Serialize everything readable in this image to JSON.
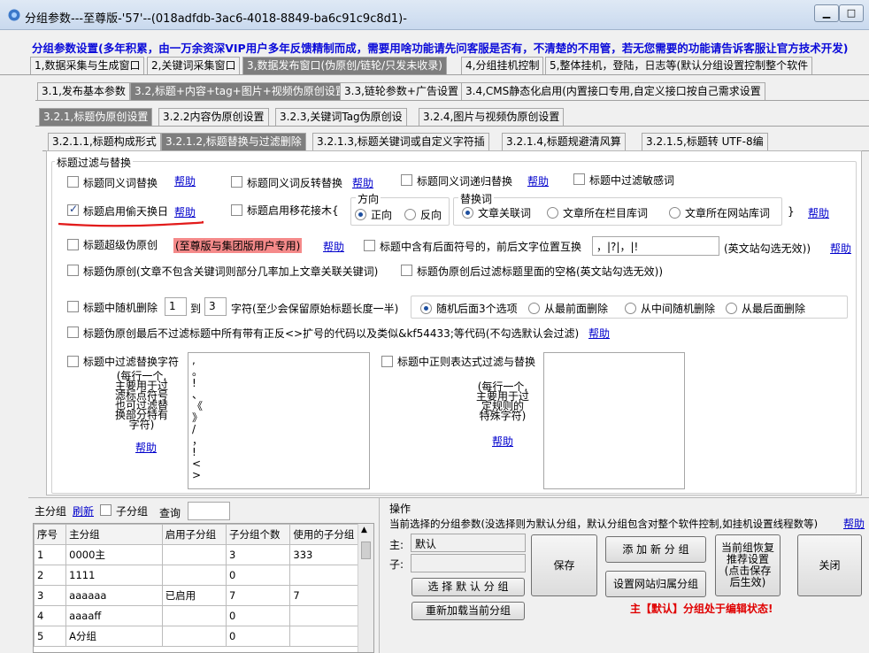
{
  "window": {
    "title": "分组参数---至尊版-'57'--(018adfdb-3ac6-4018-8849-ba6c91c9c8d1)-"
  },
  "notice": "分组参数设置(多年积累，由一万余资深VIP用户多年反馈精制而成，需要用啥功能请先问客服是否有，不清楚的不用管，若无您需要的功能请告诉客服让官方技术开发)",
  "tabs_level1": [
    {
      "label": "1,数据采集与生成窗口",
      "active": false
    },
    {
      "label": "2,关键词采集窗口",
      "active": false
    },
    {
      "label": "3,数据发布窗口(伪原创/链轮/只发未收录)",
      "active": true
    },
    {
      "label": "4,分组挂机控制",
      "active": false
    },
    {
      "label": "5,整体挂机，登陆，日志等(默认分组设置控制整个软件",
      "active": false
    }
  ],
  "tabs_level2": [
    {
      "label": "3.1,发布基本参数",
      "active": false
    },
    {
      "label": "3.2,标题+内容+tag+图片+视频伪原创设置",
      "active": true
    },
    {
      "label": "3.3,链轮参数+广告设置",
      "active": false
    },
    {
      "label": "3.4,CMS静态化启用(内置接口专用,自定义接口按自己需求设置",
      "active": false
    }
  ],
  "tabs_level3": [
    {
      "label": "3.2.1,标题伪原创设置",
      "active": true
    },
    {
      "label": "3.2.2内容伪原创设置",
      "active": false
    },
    {
      "label": "3.2.3,关键词Tag伪原创设",
      "active": false
    },
    {
      "label": "3.2.4,图片与视频伪原创设置",
      "active": false
    }
  ],
  "tabs_level4": [
    {
      "label": "3.2.1.1,标题构成形式",
      "active": false
    },
    {
      "label": "3.2.1.2,标题替换与过滤删除",
      "active": true
    },
    {
      "label": "3.2.1.3,标题关键词或自定义字符插",
      "active": false
    },
    {
      "label": "3.2.1.4,标题规避清风算",
      "active": false
    },
    {
      "label": "3.2.1.5,标题转 UTF-8编",
      "active": false
    }
  ],
  "section_title": "标题过滤与替换",
  "help": "帮助",
  "options": {
    "synonym_replace": {
      "label": "标题同义词替换",
      "checked": false
    },
    "synonym_reverse": {
      "label": "标题同义词反转替换",
      "checked": false
    },
    "synonym_recursive": {
      "label": "标题同义词递归替换",
      "checked": false
    },
    "filter_sensitive": {
      "label": "标题中过滤敏感词",
      "checked": false
    },
    "steal_swap": {
      "label": "标题启用偷天换日",
      "checked": true
    },
    "graft": {
      "label": "标题启用移花接木{",
      "checked": false
    },
    "super_pseudo": {
      "label": "标题超级伪原创",
      "checked": false
    },
    "super_pseudo_badge": "(至尊版与集团版用户专用)",
    "punct_swap": {
      "label": "标题中含有后面符号的，前后文字位置互换",
      "checked": false
    },
    "punct_swap_value": "，|?|，|!",
    "punct_swap_note": "(英文站勾选无效))",
    "pseudo_keyword": {
      "label": "标题伪原创(文章不包含关键词则部分几率加上文章关联关键词)",
      "checked": false
    },
    "filter_space": {
      "label": "标题伪原创后过滤标题里面的空格(英文站勾选无效))",
      "checked": false
    },
    "random_delete": {
      "label": "标题中随机删除",
      "checked": false
    },
    "random_from": "1",
    "random_to_label": "到",
    "random_to": "3",
    "random_suffix": "字符(至少会保留原始标题长度一半)",
    "keep_code": {
      "label": "标题伪原创最后不过滤标题中所有带有正反<>扩号的代码以及类似&kf54433;等代码(不勾选默认会过滤)",
      "checked": false
    },
    "filter_replace_chars": {
      "label": "标题中过滤替换字符",
      "checked": false
    },
    "regex_filter": {
      "label": "标题中正则表达式过滤与替换",
      "checked": false
    }
  },
  "direction": {
    "legend": "方向",
    "options": [
      {
        "label": "正向",
        "selected": true
      },
      {
        "label": "反向",
        "selected": false
      }
    ]
  },
  "replace_source": {
    "legend": "替换词",
    "options": [
      {
        "label": "文章关联词",
        "selected": true
      },
      {
        "label": "文章所在栏目库词",
        "selected": false
      },
      {
        "label": "文章所在网站库词",
        "selected": false
      }
    ],
    "close_brace": "}"
  },
  "delete_position": {
    "options": [
      {
        "label": "随机后面3个选项",
        "selected": true
      },
      {
        "label": "从最前面删除",
        "selected": false
      },
      {
        "label": "从中间随机删除",
        "selected": false
      },
      {
        "label": "从最后面删除",
        "selected": false
      }
    ]
  },
  "filter_chars_desc": [
    "(每行一个,",
    "主要用于过",
    "滤标点符号",
    "也可过滤替",
    "换部分特有",
    "字符)"
  ],
  "filter_chars_list": [
    ",",
    "。",
    "!",
    "、",
    "《",
    "》",
    "/",
    "，",
    "!",
    "<",
    ">"
  ],
  "regex_desc": [
    "(每行一个,",
    "主要用于过",
    "定规则的",
    "特殊字符)"
  ],
  "group_panel": {
    "label": "主分组",
    "refresh": "刷新",
    "sub_label": "子分组",
    "sub_checked": false,
    "query_label": "查询",
    "query_value": "",
    "columns": [
      "序号",
      "主分组",
      "启用子分组",
      "子分组个数",
      "使用的子分组"
    ],
    "rows": [
      [
        "1",
        "0000主",
        "",
        "3",
        "333"
      ],
      [
        "2",
        "1111",
        "",
        "0",
        ""
      ],
      [
        "3",
        "aaaaaa",
        "已启用",
        "7",
        "7"
      ],
      [
        "4",
        "aaaaff",
        "",
        "0",
        ""
      ],
      [
        "5",
        "A分组",
        "",
        "0",
        ""
      ]
    ]
  },
  "operations": {
    "title": "操作",
    "desc": "当前选择的分组参数(没选择则为默认分组，默认分组包含对整个软件控制,如挂机设置线程数等)",
    "main_label": "主:",
    "main_value": "默认",
    "sub_label": "子:",
    "sub_value": "",
    "select_default": "选 择 默 认 分 组",
    "reload_current": "重新加载当前分组",
    "save": "保存",
    "add_group": "添 加 新 分 组",
    "set_site_group": "设置网站归属分组",
    "restore": "当前组恢复推荐设置(点击保存后生效)",
    "close": "关闭",
    "status": "主【默认】分组处于编辑状态!"
  },
  "colors": {
    "notice": "#0b0bd9",
    "badge_bg": "#f58a8a",
    "status": "#e00000",
    "link": "#0000cc"
  }
}
